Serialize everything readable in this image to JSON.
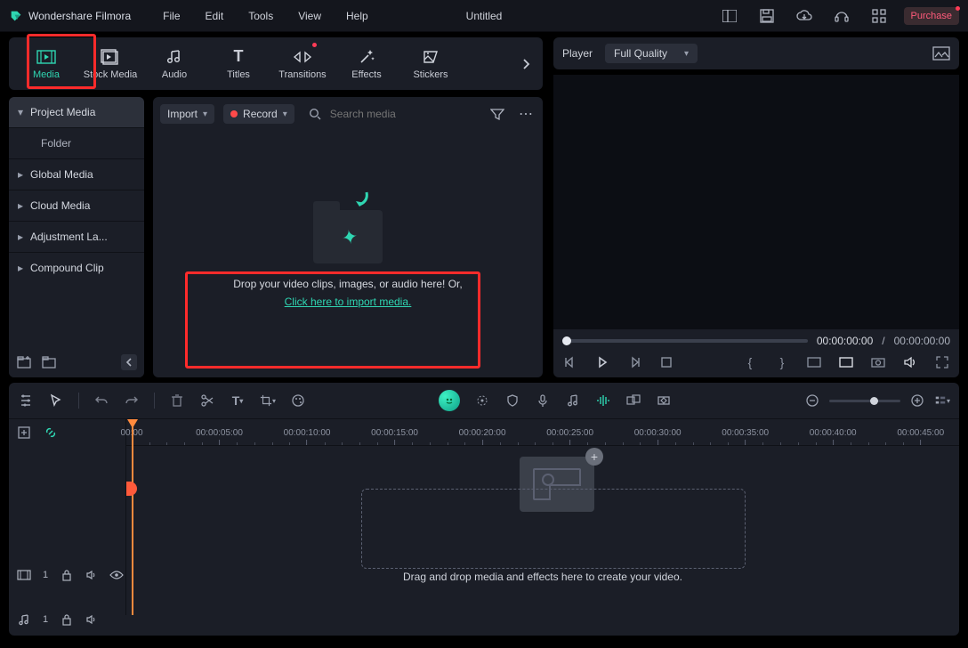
{
  "titlebar": {
    "app_name": "Wondershare Filmora",
    "menu": [
      "File",
      "Edit",
      "Tools",
      "View",
      "Help"
    ],
    "doc_title": "Untitled",
    "purchase": "Purchase"
  },
  "tabs": {
    "items": [
      {
        "label": "Media",
        "icon": "film-icon",
        "active": true
      },
      {
        "label": "Stock Media",
        "icon": "stock-icon"
      },
      {
        "label": "Audio",
        "icon": "music-icon"
      },
      {
        "label": "Titles",
        "icon": "titles-icon"
      },
      {
        "label": "Transitions",
        "icon": "transitions-icon"
      },
      {
        "label": "Effects",
        "icon": "effects-icon"
      },
      {
        "label": "Stickers",
        "icon": "stickers-icon"
      }
    ]
  },
  "sidepanel": {
    "items": [
      {
        "label": "Project Media"
      },
      {
        "label": "Folder",
        "child": true
      },
      {
        "label": "Global Media"
      },
      {
        "label": "Cloud Media"
      },
      {
        "label": "Adjustment La..."
      },
      {
        "label": "Compound Clip"
      }
    ]
  },
  "media": {
    "import": "Import",
    "record": "Record",
    "search_placeholder": "Search media",
    "drop_line1": "Drop your video clips, images, or audio here! Or,",
    "drop_link": "Click here to import media."
  },
  "player": {
    "label": "Player",
    "quality": "Full Quality",
    "cur_time": "00:00:00:00",
    "sep": "/",
    "total_time": "00:00:00:00"
  },
  "timeline": {
    "marks": [
      "00:00",
      "00:00:05:00",
      "00:00:10:00",
      "00:00:15:00",
      "00:00:20:00",
      "00:00:25:00",
      "00:00:30:00",
      "00:00:35:00",
      "00:00:40:00",
      "00:00:45:00"
    ],
    "drop_help": "Drag and drop media and effects here to create your video.",
    "video_track_index": "1",
    "audio_track_index": "1"
  }
}
